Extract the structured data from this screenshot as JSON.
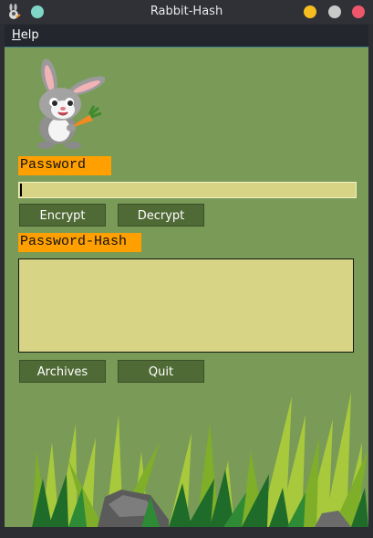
{
  "window": {
    "title": "Rabbit-Hash",
    "app_icon": "rabbit-icon",
    "controls": [
      "minimize",
      "maximize",
      "close"
    ],
    "colors": {
      "minimize": "#f5bd1f",
      "maximize": "#c9c9c9",
      "close": "#f0566b",
      "left_dot": "#7fd6c7"
    }
  },
  "menu": {
    "help_label": "Help",
    "help_mnemonic": "H",
    "help_rest": "elp"
  },
  "password": {
    "label": "Password",
    "value": ""
  },
  "buttons": {
    "encrypt": "Encrypt",
    "decrypt": "Decrypt",
    "archives": "Archives",
    "quit": "Quit"
  },
  "hash": {
    "label": "Password-Hash",
    "value": ""
  },
  "decor": {
    "mascot": "rabbit-with-carrot",
    "footer": "grass-and-rocks"
  },
  "colors": {
    "panel": "#7a9b57",
    "button": "#506a36",
    "entry": "#d8d486",
    "label_bg": "#ff9f00"
  }
}
